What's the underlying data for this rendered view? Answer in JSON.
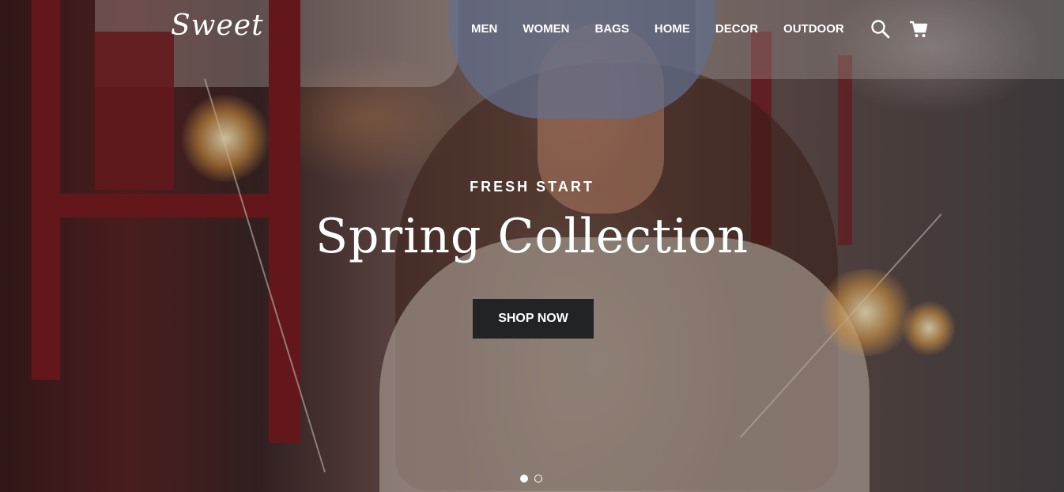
{
  "brand": {
    "logo_text": "Sweet"
  },
  "nav": {
    "items": [
      {
        "label": "MEN"
      },
      {
        "label": "WOMEN"
      },
      {
        "label": "BAGS"
      },
      {
        "label": "HOME"
      },
      {
        "label": "DECOR"
      },
      {
        "label": "OUTDOOR"
      }
    ],
    "icons": {
      "search": "search-icon",
      "cart": "cart-icon"
    }
  },
  "hero": {
    "eyebrow": "FRESH START",
    "title": "Spring Collection",
    "cta_label": "SHOP NOW",
    "slides_total": 2,
    "active_slide": 1
  },
  "colors": {
    "text": "#ffffff",
    "button_bg": "#222324",
    "accent_red": "#7a1d22"
  }
}
